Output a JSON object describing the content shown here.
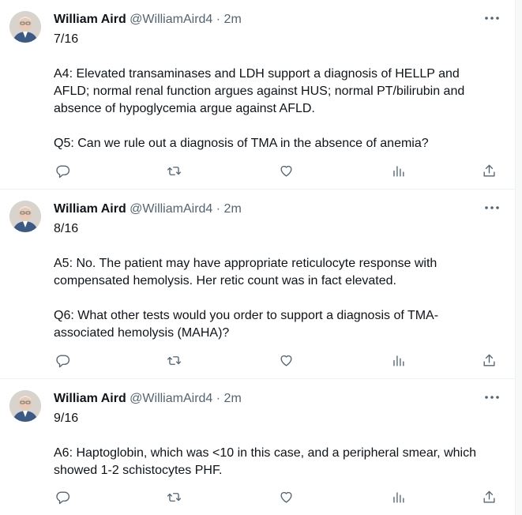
{
  "tweets": [
    {
      "author": "William Aird",
      "handle": "@WilliamAird4",
      "separator": "·",
      "time": "2m",
      "lines": [
        "7/16",
        "",
        "A4: Elevated transaminases and LDH support a diagnosis of HELLP and",
        "AFLD; normal renal function argues against HUS; normal PT/bilirubin and",
        "absence of hypoglycemia argue against AFLD.",
        "",
        "Q5: Can we rule out a diagnosis of TMA in the absence of anemia?"
      ]
    },
    {
      "author": "William Aird",
      "handle": "@WilliamAird4",
      "separator": "·",
      "time": "2m",
      "lines": [
        "8/16",
        "",
        "A5: No. The patient may have appropriate reticulocyte response with",
        "compensated hemolysis. Her retic count was in fact elevated.",
        "",
        "Q6: What other tests would you order to support a diagnosis of TMA-",
        "associated hemolysis (MAHA)?"
      ]
    },
    {
      "author": "William Aird",
      "handle": "@WilliamAird4",
      "separator": "·",
      "time": "2m",
      "lines": [
        "9/16",
        "",
        "A6: Haptoglobin, which was <10 in this case, and a peripheral smear, which",
        "showed 1-2 schistocytes PHF."
      ]
    }
  ],
  "icons": {
    "more": "more-icon",
    "reply": "reply-icon",
    "retweet": "retweet-icon",
    "like": "like-icon",
    "views": "views-icon",
    "share": "share-icon"
  },
  "colors": {
    "text": "#0f1419",
    "secondary": "#536471",
    "divider": "#eff3f4"
  }
}
